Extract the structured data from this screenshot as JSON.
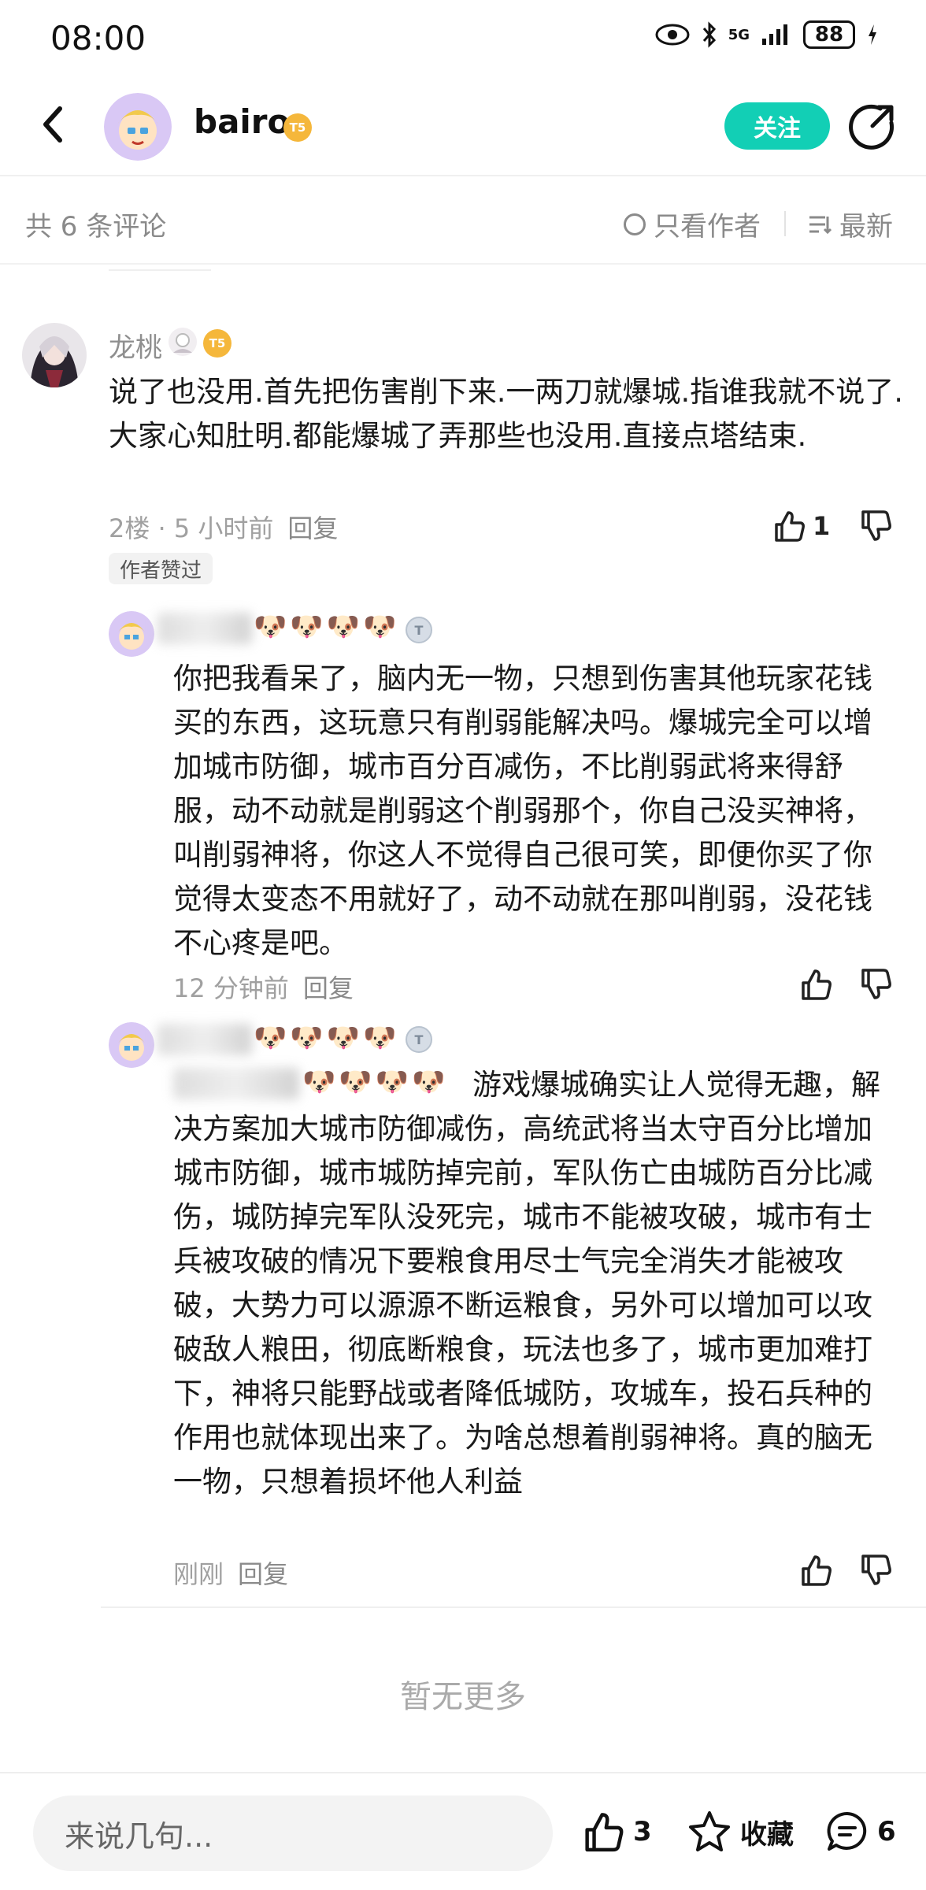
{
  "status_bar": {
    "time": "08:00",
    "network": "5G",
    "battery": "88"
  },
  "header": {
    "username": "bairo",
    "level_badge": "T5",
    "follow_label": "关注"
  },
  "sort_bar": {
    "count": "共 6 条评论",
    "only_author": "只看作者",
    "latest": "最新"
  },
  "comment": {
    "author": "龙桃",
    "level_badge": "T5",
    "text": "说了也没用.首先把伤害削下来.一两刀就爆城.指谁我就不说了.大家心知肚明.都能爆城了弄那些也没用.直接点塔结束.",
    "floor_time": "2楼 · 5 小时前",
    "reply_label": "回复",
    "likes": "1",
    "author_liked": "作者赞过"
  },
  "replies": [
    {
      "name_emoji": "🐶🐶🐶🐶",
      "text": "你把我看呆了，脑内无一物，只想到伤害其他玩家花钱买的东西，这玩意只有削弱能解决吗。爆城完全可以增加城市防御，城市百分百减伤，不比削弱武将来得舒服，动不动就是削弱这个削弱那个，你自己没买神将，叫削弱神将，你这人不觉得自己很可笑，即便你买了你觉得太变态不用就好了，动不动就在那叫削弱，没花钱不心疼是吧。",
      "time": "12 分钟前",
      "reply_label": "回复"
    },
    {
      "name_emoji": "🐶🐶🐶🐶",
      "quote_emoji": "🐶🐶🐶🐶",
      "text": "游戏爆城确实让人觉得无趣，解决方案加大城市防御减伤，高统武将当太守百分比增加城市防御，城市城防掉完前，军队伤亡由城防百分比减伤，城防掉完军队没死完，城市不能被攻破，城市有士兵被攻破的情况下要粮食用尽士气完全消失才能被攻破，大势力可以源源不断运粮食，另外可以增加可以攻破敌人粮田，彻底断粮食，玩法也多了，城市更加难打下，神将只能野战或者降低城防，攻城车，投石兵种的作用也就体现出来了。为啥总想着削弱神将。真的脑无一物，只想着损坏他人利益",
      "time": "刚刚",
      "reply_label": "回复"
    }
  ],
  "no_more": "暂无更多",
  "bottom_bar": {
    "placeholder": "来说几句...",
    "likes": "3",
    "collect": "收藏",
    "comments": "6"
  }
}
